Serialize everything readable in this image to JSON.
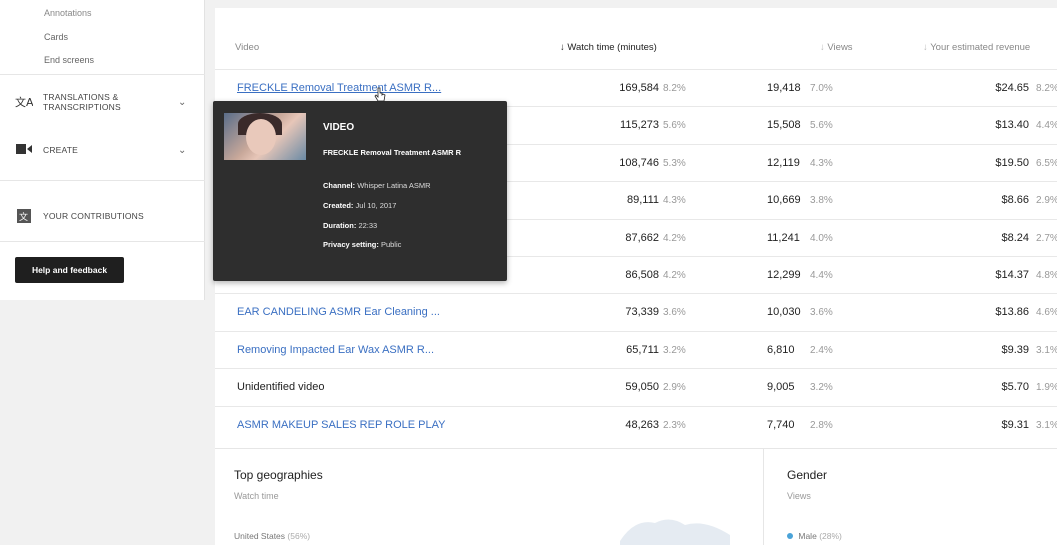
{
  "sidebar": {
    "sub_links": [
      "Annotations",
      "Cards",
      "End screens"
    ],
    "nav": [
      {
        "label": "TRANSLATIONS & TRANSCRIPTIONS",
        "icon": "translate-icon"
      },
      {
        "label": "CREATE",
        "icon": "video-camera-icon"
      },
      {
        "label": "YOUR CONTRIBUTIONS",
        "icon": "contributions-icon"
      }
    ],
    "help_label": "Help and feedback"
  },
  "table": {
    "headers": {
      "video": "Video",
      "watch_time": "Watch time (minutes)",
      "views": "Views",
      "revenue": "Your estimated revenue"
    },
    "rows": [
      {
        "title": "FRECKLE Removal Treatment ASMR R...",
        "watch_time": "169,584",
        "watch_pct": "8.2%",
        "views": "19,418",
        "views_pct": "7.0%",
        "revenue": "$24.65",
        "revenue_pct": "8.2%",
        "link": true
      },
      {
        "title": "",
        "watch_time": "115,273",
        "watch_pct": "5.6%",
        "views": "15,508",
        "views_pct": "5.6%",
        "revenue": "$13.40",
        "revenue_pct": "4.4%",
        "link": true
      },
      {
        "title": "",
        "watch_time": "108,746",
        "watch_pct": "5.3%",
        "views": "12,119",
        "views_pct": "4.3%",
        "revenue": "$19.50",
        "revenue_pct": "6.5%",
        "link": true
      },
      {
        "title": "",
        "watch_time": "89,111",
        "watch_pct": "4.3%",
        "views": "10,669",
        "views_pct": "3.8%",
        "revenue": "$8.66",
        "revenue_pct": "2.9%",
        "link": true
      },
      {
        "title": "",
        "watch_time": "87,662",
        "watch_pct": "4.2%",
        "views": "11,241",
        "views_pct": "4.0%",
        "revenue": "$8.24",
        "revenue_pct": "2.7%",
        "link": true
      },
      {
        "title": "",
        "watch_time": "86,508",
        "watch_pct": "4.2%",
        "views": "12,299",
        "views_pct": "4.4%",
        "revenue": "$14.37",
        "revenue_pct": "4.8%",
        "link": true
      },
      {
        "title": "EAR CANDELING ASMR Ear Cleaning ...",
        "watch_time": "73,339",
        "watch_pct": "3.6%",
        "views": "10,030",
        "views_pct": "3.6%",
        "revenue": "$13.86",
        "revenue_pct": "4.6%",
        "link": true
      },
      {
        "title": "Removing Impacted Ear Wax ASMR R...",
        "watch_time": "65,711",
        "watch_pct": "3.2%",
        "views": "6,810",
        "views_pct": "2.4%",
        "revenue": "$9.39",
        "revenue_pct": "3.1%",
        "link": true
      },
      {
        "title": "Unidentified video",
        "watch_time": "59,050",
        "watch_pct": "2.9%",
        "views": "9,005",
        "views_pct": "3.2%",
        "revenue": "$5.70",
        "revenue_pct": "1.9%",
        "link": false
      },
      {
        "title": "ASMR MAKEUP SALES REP ROLE PLAY",
        "watch_time": "48,263",
        "watch_pct": "2.3%",
        "views": "7,740",
        "views_pct": "2.8%",
        "revenue": "$9.31",
        "revenue_pct": "3.1%",
        "link": true
      }
    ]
  },
  "geographies": {
    "title": "Top geographies",
    "subtitle": "Watch time",
    "first_line": "United States",
    "first_pct": "(56%)"
  },
  "gender": {
    "title": "Gender",
    "subtitle": "Views",
    "first_line": "Male",
    "first_pct": "(28%)"
  },
  "tooltip": {
    "type": "VIDEO",
    "title": "FRECKLE Removal Treatment ASMR R",
    "channel_label": "Channel:",
    "channel": "Whisper Latina ASMR",
    "created_label": "Created:",
    "created": "Jul 10, 2017",
    "duration_label": "Duration:",
    "duration": "22:33",
    "privacy_label": "Privacy setting:",
    "privacy": "Public"
  }
}
